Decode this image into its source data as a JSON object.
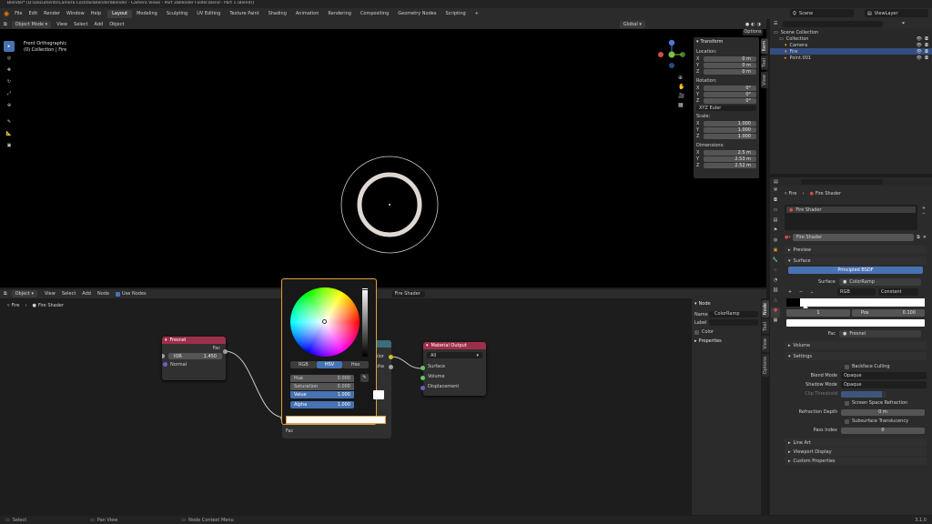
{
  "titlebar": {
    "text": "Blender* [D:\\Documents\\Camera Cocktail\\Blender\\Blender - Camera Views - Part 3\\Blender Folder.blend - Part 1 (Blend)]"
  },
  "menu": [
    "File",
    "Edit",
    "Render",
    "Window",
    "Help"
  ],
  "workspace_tabs": [
    "Layout",
    "Modeling",
    "Sculpting",
    "UV Editing",
    "Texture Paint",
    "Shading",
    "Animation",
    "Rendering",
    "Compositing",
    "Geometry Nodes",
    "Scripting",
    "+"
  ],
  "active_tab": "Layout",
  "scene": {
    "label": "Scene",
    "view_layer": "ViewLayer"
  },
  "viewport_header": {
    "mode": "Object Mode",
    "menus": [
      "View",
      "Select",
      "Add",
      "Object"
    ],
    "transform": "Global",
    "options": "Options"
  },
  "viewport": {
    "overlay_line1": "Front Orthographic",
    "overlay_line2": "(0) Collection | Fire",
    "gizmo": {
      "z": "Z",
      "x": "X",
      "y": "Y"
    }
  },
  "n_panel": {
    "title": "Transform",
    "location_label": "Location:",
    "location": [
      {
        "axis": "X",
        "value": "0 m"
      },
      {
        "axis": "Y",
        "value": "0 m"
      },
      {
        "axis": "Z",
        "value": "0 m"
      }
    ],
    "rotation_label": "Rotation:",
    "rotation": [
      {
        "axis": "X",
        "value": "0°"
      },
      {
        "axis": "Y",
        "value": "0°"
      },
      {
        "axis": "Z",
        "value": "0°"
      }
    ],
    "rotation_mode": "XYZ Euler",
    "scale_label": "Scale:",
    "scale": [
      {
        "axis": "X",
        "value": "1.000"
      },
      {
        "axis": "Y",
        "value": "1.000"
      },
      {
        "axis": "Z",
        "value": "1.000"
      }
    ],
    "dimensions_label": "Dimensions:",
    "dimensions": [
      {
        "axis": "X",
        "value": "2.5 m"
      },
      {
        "axis": "Y",
        "value": "2.53 m"
      },
      {
        "axis": "Z",
        "value": "2.52 m"
      }
    ],
    "tabs": [
      "Item",
      "Tool",
      "View"
    ]
  },
  "outliner": {
    "title": "Scene Collection",
    "items": [
      {
        "name": "Collection",
        "level": 1
      },
      {
        "name": "Camera",
        "level": 2
      },
      {
        "name": "Fire",
        "level": 2,
        "selected": true
      },
      {
        "name": "Point.001",
        "level": 2
      }
    ]
  },
  "node_header": {
    "type": "Object",
    "menus": [
      "View",
      "Select",
      "Add",
      "Node"
    ],
    "use_nodes": "Use Nodes",
    "material": "Fire Shader",
    "breadcrumb_obj": "Fire",
    "breadcrumb_mat": "Fire Shader"
  },
  "nodes": {
    "fresnel": {
      "title": "Fresnel",
      "output": "Fac",
      "ior_label": "IOR",
      "ior_value": "1.450",
      "normal": "Normal"
    },
    "material_output": {
      "title": "Material Output",
      "target": "All",
      "inputs": [
        "Surface",
        "Volume",
        "Displacement"
      ]
    },
    "ramp": {
      "outputs": [
        "Color",
        "Alpha"
      ],
      "input": "Fac"
    }
  },
  "color_picker": {
    "tabs": [
      "RGB",
      "HSV",
      "Hex"
    ],
    "active_tab": "HSV",
    "fields": [
      {
        "label": "Hue",
        "value": "0.000"
      },
      {
        "label": "Saturation",
        "value": "0.000"
      },
      {
        "label": "Value",
        "value": "1.000"
      },
      {
        "label": "Alpha",
        "value": "1.000"
      }
    ]
  },
  "node_sidebar": {
    "node_title": "Node",
    "name_label": "Name",
    "name_value": "ColorRamp",
    "label_label": "Label",
    "color_label": "Color",
    "properties_title": "Properties",
    "tabs": [
      "Node",
      "Tool",
      "View",
      "Options"
    ]
  },
  "properties": {
    "breadcrumb_obj": "Fire",
    "breadcrumb_mat": "Fire Shader",
    "slot": "Fire Shader",
    "material_name": "Fire Shader",
    "sections": {
      "preview": "Preview",
      "surface": "Surface",
      "volume": "Volume",
      "settings": "Settings",
      "line_art": "Line Art",
      "viewport_display": "Viewport Display",
      "custom_props": "Custom Properties"
    },
    "surface_node": "Principled BSDF",
    "surface_label": "Surface",
    "surface_value": "ColorRamp",
    "ramp_mode": "RGB",
    "ramp_interp": "Constant",
    "ramp_pos_label": "Pos",
    "ramp_index": "1",
    "ramp_pos_value": "0.100",
    "fac_label": "Fac",
    "fac_value": "Fresnel",
    "settings": {
      "backface": "Backface Culling",
      "blend_label": "Blend Mode",
      "blend_value": "Opaque",
      "shadow_label": "Shadow Mode",
      "shadow_value": "Opaque",
      "clip_label": "Clip Threshold",
      "screen_refraction": "Screen Space Refraction",
      "refraction_label": "Refraction Depth",
      "refraction_value": "0 m",
      "subsurface": "Subsurface Translucency",
      "pass_label": "Pass Index",
      "pass_value": "0"
    }
  },
  "statusbar": {
    "left": "Select",
    "mid": "Pan View",
    "right": "Node Context Menu",
    "version": "3.1.0"
  }
}
